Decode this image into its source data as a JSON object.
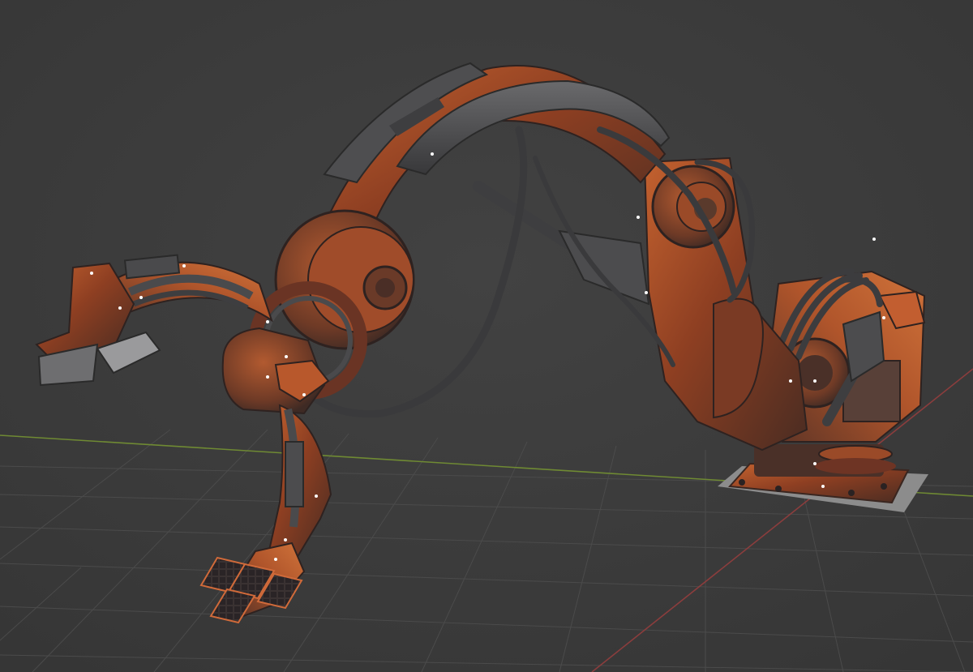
{
  "viewport": {
    "background": "#3d3d3d",
    "grid_color": "#4a4a4a",
    "x_axis_color": "#9a4a4a",
    "y_axis_color": "#7a9a3a"
  },
  "model": {
    "rust_color": "#b8532a",
    "metal_color": "#4a4a4c",
    "cable_color": "#3a3a3c",
    "base_plate_color": "#8a8a8a"
  }
}
